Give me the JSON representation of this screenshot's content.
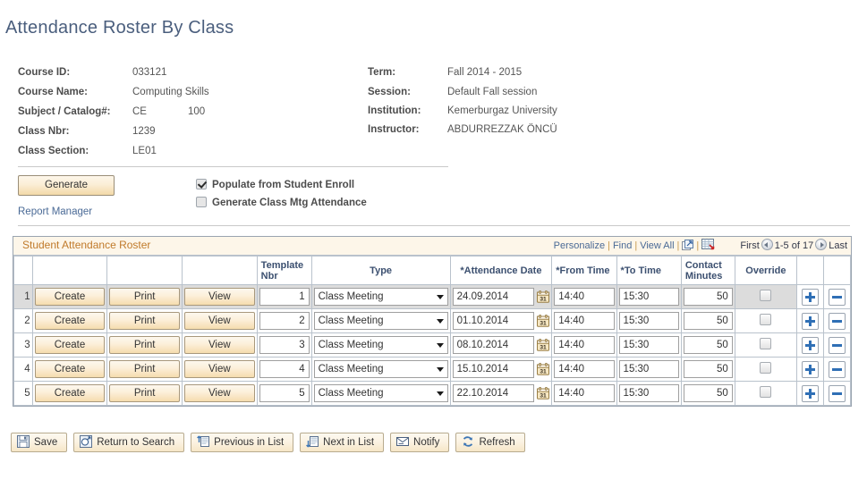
{
  "page": {
    "title": "Attendance Roster By Class"
  },
  "header": {
    "left": [
      {
        "label": "Course ID:",
        "value": "033121"
      },
      {
        "label": "Course Name:",
        "value": "Computing Skills"
      },
      {
        "label": "Subject / Catalog#:",
        "value": "CE",
        "value2": "100"
      },
      {
        "label": "Class Nbr:",
        "value": "1239"
      },
      {
        "label": "Class Section:",
        "value": "LE01"
      }
    ],
    "right": [
      {
        "label": "Term:",
        "value": "Fall 2014 - 2015"
      },
      {
        "label": "Session:",
        "value": "Default Fall session"
      },
      {
        "label": "Institution:",
        "value": "Kemerburgaz University"
      },
      {
        "label": "Instructor:",
        "value": "ABDURREZZAK ÖNCÜ"
      }
    ]
  },
  "actions": {
    "generate_label": "Generate",
    "report_manager_label": "Report Manager",
    "checkboxes": [
      {
        "label": "Populate from Student Enroll",
        "checked": true,
        "name": "populate-from-student-enroll"
      },
      {
        "label": "Generate Class Mtg Attendance",
        "checked": false,
        "name": "generate-class-mtg-attendance"
      }
    ]
  },
  "grid": {
    "caption": "Student Attendance Roster",
    "nav": {
      "personalize": "Personalize",
      "find": "Find",
      "view_all": "View All",
      "expand_icon": "expand-icon",
      "download_icon": "download-to-spreadsheet-icon",
      "first": "First",
      "range": "1-5 of 17",
      "last": "Last"
    },
    "columns": [
      {
        "label": "",
        "name": "row-number"
      },
      {
        "label": "",
        "name": "create"
      },
      {
        "label": "",
        "name": "print"
      },
      {
        "label": "",
        "name": "view"
      },
      {
        "label": "Template Nbr",
        "name": "template-nbr"
      },
      {
        "label": "Type",
        "name": "type"
      },
      {
        "label": "*Attendance Date",
        "name": "attendance-date"
      },
      {
        "label": "*From Time",
        "name": "from-time"
      },
      {
        "label": "*To Time",
        "name": "to-time"
      },
      {
        "label": "Contact Minutes",
        "name": "contact-minutes"
      },
      {
        "label": "Override",
        "name": "override"
      },
      {
        "label": "",
        "name": "add-row"
      },
      {
        "label": "",
        "name": "delete-row"
      }
    ],
    "row_buttons": {
      "create": "Create",
      "print": "Print",
      "view": "View"
    },
    "rows": [
      {
        "num": "1",
        "template_nbr": "1",
        "type": "Class Meeting",
        "date": "24.09.2014",
        "from": "14:40",
        "to": "15:30",
        "minutes": "50",
        "override": false,
        "selected": true
      },
      {
        "num": "2",
        "template_nbr": "2",
        "type": "Class Meeting",
        "date": "01.10.2014",
        "from": "14:40",
        "to": "15:30",
        "minutes": "50",
        "override": false,
        "selected": false
      },
      {
        "num": "3",
        "template_nbr": "3",
        "type": "Class Meeting",
        "date": "08.10.2014",
        "from": "14:40",
        "to": "15:30",
        "minutes": "50",
        "override": false,
        "selected": false
      },
      {
        "num": "4",
        "template_nbr": "4",
        "type": "Class Meeting",
        "date": "15.10.2014",
        "from": "14:40",
        "to": "15:30",
        "minutes": "50",
        "override": false,
        "selected": false
      },
      {
        "num": "5",
        "template_nbr": "5",
        "type": "Class Meeting",
        "date": "22.10.2014",
        "from": "14:40",
        "to": "15:30",
        "minutes": "50",
        "override": false,
        "selected": false
      }
    ]
  },
  "toolbar": [
    {
      "label": "Save",
      "icon": "save-icon",
      "name": "save-button"
    },
    {
      "label": "Return to Search",
      "icon": "search-back-icon",
      "name": "return-to-search-button"
    },
    {
      "label": "Previous in List",
      "icon": "previous-in-list-icon",
      "name": "previous-in-list-button"
    },
    {
      "label": "Next in List",
      "icon": "next-in-list-icon",
      "name": "next-in-list-button"
    },
    {
      "label": "Notify",
      "icon": "notify-envelope-icon",
      "name": "notify-button"
    },
    {
      "label": "Refresh",
      "icon": "refresh-icon",
      "name": "refresh-button"
    }
  ],
  "colors": {
    "title": "#4a5e7d",
    "link": "#4a6a96",
    "caption": "#c07a2a",
    "button_gold": "#f5dcae",
    "selected_row": "#dcdcdc",
    "plus_minus_blue": "#2f6fb5"
  }
}
